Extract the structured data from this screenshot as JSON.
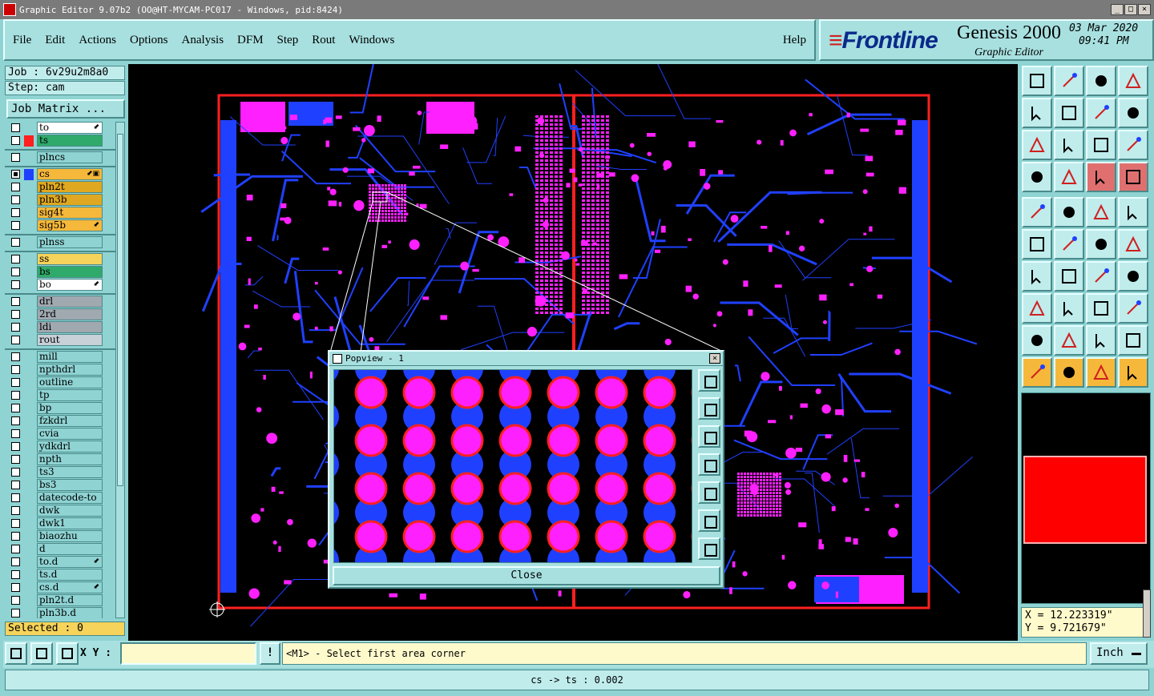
{
  "window": {
    "title": "Graphic Editor 9.07b2 (OO@HT-MYCAM-PC017 - Windows, pid:8424)",
    "controls": [
      "_",
      "□",
      "×"
    ]
  },
  "menu": {
    "items": [
      "File",
      "Edit",
      "Actions",
      "Options",
      "Analysis",
      "DFM",
      "Step",
      "Rout",
      "Windows"
    ],
    "help": "Help"
  },
  "branding": {
    "logo": "Frontline",
    "product": "Genesis 2000",
    "subtitle": "Graphic Editor",
    "date": "03 Mar 2020",
    "time": "09:41 PM"
  },
  "job": {
    "job_label": "Job  : 6v29u2m8a0",
    "step_label": "Step: cam",
    "matrix_button": "Job Matrix ..."
  },
  "layers": [
    {
      "name": "to",
      "color": "#ffffff",
      "checked": false,
      "flag": "⬋"
    },
    {
      "name": "ts",
      "color": "#2faa6a",
      "checked": false,
      "swatch": "#ff2020"
    },
    {
      "name": "plncs",
      "color": "#8fd3d3",
      "checked": false,
      "sep_before": true
    },
    {
      "name": "cs",
      "color": "#f6b83a",
      "checked": true,
      "swatch": "#2040ff",
      "flag": "⬋▣",
      "sep_before": true
    },
    {
      "name": "pln2t",
      "color": "#e0a820",
      "checked": false
    },
    {
      "name": "pln3b",
      "color": "#e0a820",
      "checked": false
    },
    {
      "name": "sig4t",
      "color": "#f6b83a",
      "checked": false
    },
    {
      "name": "sig5b",
      "color": "#f6b83a",
      "checked": false,
      "flag": "⬋"
    },
    {
      "name": "plnss",
      "color": "#8fd3d3",
      "checked": false,
      "sep_before": true
    },
    {
      "name": "ss",
      "color": "#f6d35a",
      "checked": false,
      "sep_before": true
    },
    {
      "name": "bs",
      "color": "#2faa6a",
      "checked": false
    },
    {
      "name": "bo",
      "color": "#ffffff",
      "checked": false,
      "flag": "⬋"
    },
    {
      "name": "drl",
      "color": "#a0a8b0",
      "checked": false,
      "sep_before": true
    },
    {
      "name": "2rd",
      "color": "#a0a8b0",
      "checked": false
    },
    {
      "name": "ldi",
      "color": "#a0a8b0",
      "checked": false
    },
    {
      "name": "rout",
      "color": "#c8d0d8",
      "checked": false
    },
    {
      "name": "mill",
      "color": "#8fd3d3",
      "checked": false,
      "sep_before": true
    },
    {
      "name": "npthdrl",
      "color": "#8fd3d3",
      "checked": false
    },
    {
      "name": "outline",
      "color": "#8fd3d3",
      "checked": false
    },
    {
      "name": "tp",
      "color": "#8fd3d3",
      "checked": false
    },
    {
      "name": "bp",
      "color": "#8fd3d3",
      "checked": false
    },
    {
      "name": "fzkdrl",
      "color": "#8fd3d3",
      "checked": false
    },
    {
      "name": "cvia",
      "color": "#8fd3d3",
      "checked": false
    },
    {
      "name": "ydkdrl",
      "color": "#8fd3d3",
      "checked": false
    },
    {
      "name": "npth",
      "color": "#8fd3d3",
      "checked": false
    },
    {
      "name": "ts3",
      "color": "#8fd3d3",
      "checked": false
    },
    {
      "name": "bs3",
      "color": "#8fd3d3",
      "checked": false
    },
    {
      "name": "datecode-to",
      "color": "#8fd3d3",
      "checked": false
    },
    {
      "name": "dwk",
      "color": "#8fd3d3",
      "checked": false
    },
    {
      "name": "dwk1",
      "color": "#8fd3d3",
      "checked": false
    },
    {
      "name": "biaozhu",
      "color": "#8fd3d3",
      "checked": false
    },
    {
      "name": "d",
      "color": "#8fd3d3",
      "checked": false
    },
    {
      "name": "to.d",
      "color": "#8fd3d3",
      "checked": false,
      "flag": "⬋"
    },
    {
      "name": "ts.d",
      "color": "#8fd3d3",
      "checked": false
    },
    {
      "name": "cs.d",
      "color": "#8fd3d3",
      "checked": false,
      "flag": "⬋"
    },
    {
      "name": "pln2t.d",
      "color": "#8fd3d3",
      "checked": false
    },
    {
      "name": "pln3b.d",
      "color": "#8fd3d3",
      "checked": false
    }
  ],
  "selected_label": "Selected : 0",
  "popview": {
    "title": "Popview - 1",
    "close_label": "Close"
  },
  "colors": {
    "trace": "#2040ff",
    "pad": "#ff20ff",
    "outline": "#ff2020",
    "panel": "#8fd3d3"
  },
  "coords": {
    "x": "X = 12.223319\"",
    "y": "Y = 9.721679\""
  },
  "bottom": {
    "xy_label": "X Y :",
    "xy_value": "",
    "exclaim": "!",
    "prompt": "<M1> - Select first area corner",
    "unit": "Inch"
  },
  "status": "cs -> ts : 0.002"
}
